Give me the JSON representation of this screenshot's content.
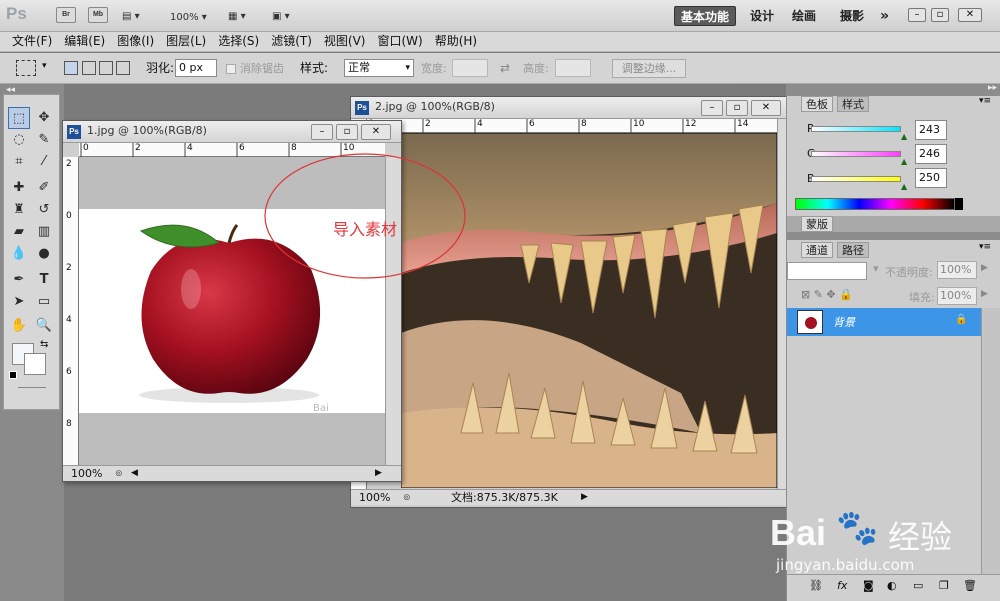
{
  "app": {
    "logo": "Ps",
    "bridge_btn": "Br",
    "mini_btn": "Mb",
    "zoom": "100%",
    "workspaces": [
      "基本功能",
      "设计",
      "绘画",
      "摄影"
    ],
    "more": "»"
  },
  "menu": [
    "文件(F)",
    "编辑(E)",
    "图像(I)",
    "图层(L)",
    "选择(S)",
    "滤镜(T)",
    "视图(V)",
    "窗口(W)",
    "帮助(H)"
  ],
  "options": {
    "feather_label": "羽化:",
    "feather_value": "0 px",
    "antialias_label": "消除锯齿",
    "style_label": "样式:",
    "style_value": "正常",
    "width_label": "宽度:",
    "height_label": "高度:",
    "refine_edge": "调整边缘..."
  },
  "doc1": {
    "title": "1.jpg @ 100%(RGB/8)",
    "zoom": "100%",
    "annotation": "导入素材",
    "hruler": [
      "0",
      "2",
      "4",
      "6",
      "8",
      "10"
    ],
    "vruler": [
      "2",
      "0",
      "2",
      "4",
      "6",
      "8"
    ],
    "watermark": "Bai"
  },
  "doc2": {
    "title": "2.jpg @ 100%(RGB/8)",
    "zoom": "100%",
    "docinfo": "文档:875.3K/875.3K",
    "hruler": [
      "2",
      "4",
      "6",
      "8",
      "10",
      "12",
      "14"
    ]
  },
  "color_panel": {
    "tabs": [
      "色板",
      "样式"
    ],
    "channels": [
      {
        "label": "R",
        "value": "243",
        "fraction": 0.953,
        "color": "#00e5ff"
      },
      {
        "label": "G",
        "value": "246",
        "fraction": 0.965,
        "color": "#ff3dff"
      },
      {
        "label": "B",
        "value": "250",
        "fraction": 0.98,
        "color": "#ffff00"
      }
    ]
  },
  "layers_panel": {
    "top_tab": "蒙版",
    "tabs": [
      "通道",
      "路径"
    ],
    "opacity_label": "不透明度:",
    "opacity_value": "100%",
    "fill_label": "填充:",
    "fill_value": "100%",
    "layer_name": "背景"
  },
  "watermark": {
    "brand": "Bai",
    "brand_cn": "经验",
    "url": "jingyan.baidu.com"
  }
}
